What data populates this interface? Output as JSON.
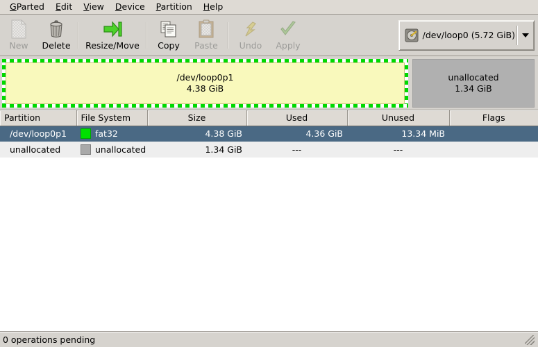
{
  "window": {
    "title": "GParted"
  },
  "menubar": {
    "items": [
      {
        "label": "GParted",
        "mnemonic": "G"
      },
      {
        "label": "Edit",
        "mnemonic": "E"
      },
      {
        "label": "View",
        "mnemonic": "V"
      },
      {
        "label": "Device",
        "mnemonic": "D"
      },
      {
        "label": "Partition",
        "mnemonic": "P"
      },
      {
        "label": "Help",
        "mnemonic": "H"
      }
    ]
  },
  "toolbar": {
    "buttons": [
      {
        "label": "New",
        "icon": "new-document-icon",
        "enabled": false
      },
      {
        "label": "Delete",
        "icon": "trash-can-icon",
        "enabled": true
      },
      {
        "label": "Resize/Move",
        "icon": "resize-arrow-icon",
        "enabled": true
      },
      {
        "label": "Copy",
        "icon": "copy-icon",
        "enabled": true
      },
      {
        "label": "Paste",
        "icon": "paste-clipboard-icon",
        "enabled": false
      },
      {
        "label": "Undo",
        "icon": "undo-arrow-icon",
        "enabled": false
      },
      {
        "label": "Apply",
        "icon": "apply-check-icon",
        "enabled": false
      }
    ],
    "device_selector": {
      "icon": "hard-drive-icon",
      "value": "/dev/loop0  (5.72 GiB)",
      "arrow_icon": "chevron-down-icon"
    }
  },
  "disk_graphic": {
    "selected_partition": {
      "name": "/dev/loop0p1",
      "size": "4.38 GiB",
      "fill_color": "#f9f9bc",
      "selection_color": "#00d900",
      "selected": true
    },
    "unallocated": {
      "name": "unallocated",
      "size": "1.34 GiB",
      "fill_color": "#b0b0b0"
    }
  },
  "table": {
    "columns": [
      "Partition",
      "File System",
      "Size",
      "Used",
      "Unused",
      "Flags"
    ],
    "rows": [
      {
        "partition": "/dev/loop0p1",
        "filesystem": "fat32",
        "fs_color": "#00e000",
        "size": "4.38 GiB",
        "used": "4.36 GiB",
        "unused": "13.34 MiB",
        "flags": "",
        "selected": true
      },
      {
        "partition": "unallocated",
        "filesystem": "unallocated",
        "fs_color": "#a9a9a9",
        "size": "1.34 GiB",
        "used": "---",
        "unused": "---",
        "flags": "",
        "selected": false
      }
    ],
    "selection_color": "#4a6984"
  },
  "statusbar": {
    "text": "0 operations pending"
  }
}
